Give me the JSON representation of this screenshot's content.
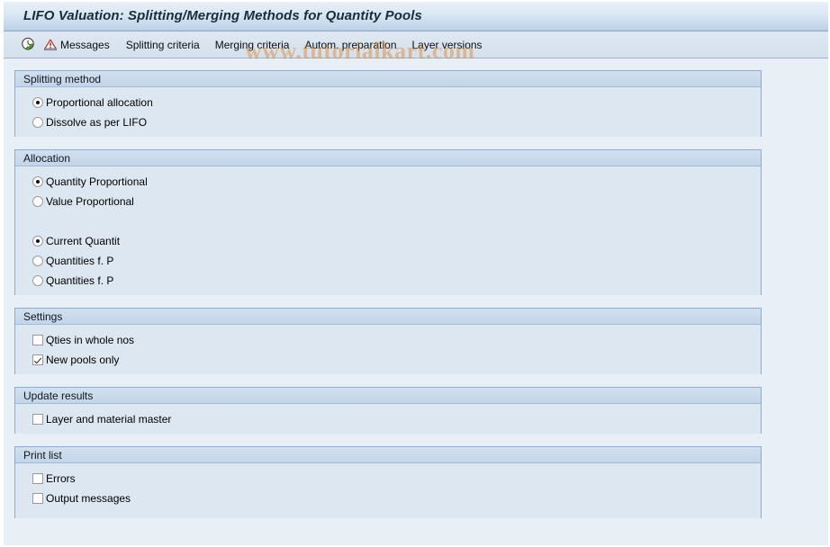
{
  "window": {
    "title": "LIFO Valuation: Splitting/Merging Methods for Quantity Pools"
  },
  "watermark": {
    "text": "www.tutorialkart.com"
  },
  "toolbar": {
    "execute_icon": "execute-clock-check-icon",
    "messages_icon": "messages-warning-icon",
    "messages_label": "Messages",
    "splitting_criteria_label": "Splitting criteria",
    "merging_criteria_label": "Merging criteria",
    "autom_preparation_label": "Autom. preparation",
    "layer_versions_label": "Layer versions"
  },
  "sections": {
    "splitting_method": {
      "title": "Splitting method",
      "options": [
        {
          "label": "Proportional allocation",
          "selected": true
        },
        {
          "label": "Dissolve as per LIFO",
          "selected": false
        }
      ]
    },
    "allocation": {
      "title": "Allocation",
      "group_one": [
        {
          "label": "Quantity Proportional",
          "selected": true
        },
        {
          "label": "Value Proportional",
          "selected": false
        }
      ],
      "group_two": [
        {
          "label": "Current Quantit",
          "selected": true
        },
        {
          "label": "Quantities f. P",
          "selected": false
        },
        {
          "label": "Quantities f. P",
          "selected": false
        }
      ]
    },
    "settings": {
      "title": "Settings",
      "options": [
        {
          "label": "Qties in whole nos",
          "checked": false
        },
        {
          "label": "New pools only",
          "checked": true
        }
      ]
    },
    "update_results": {
      "title": "Update results",
      "options": [
        {
          "label": "Layer and material master",
          "checked": false
        }
      ]
    },
    "print_list": {
      "title": "Print list",
      "options": [
        {
          "label": "Errors",
          "checked": false
        },
        {
          "label": "Output messages",
          "checked": false
        }
      ]
    }
  },
  "colors": {
    "window_bg": "#e9eff7",
    "panel_bg": "#dce7f1",
    "panel_border": "#8fadd0",
    "title_text": "#1c2b3c",
    "watermark": "#de8328"
  }
}
